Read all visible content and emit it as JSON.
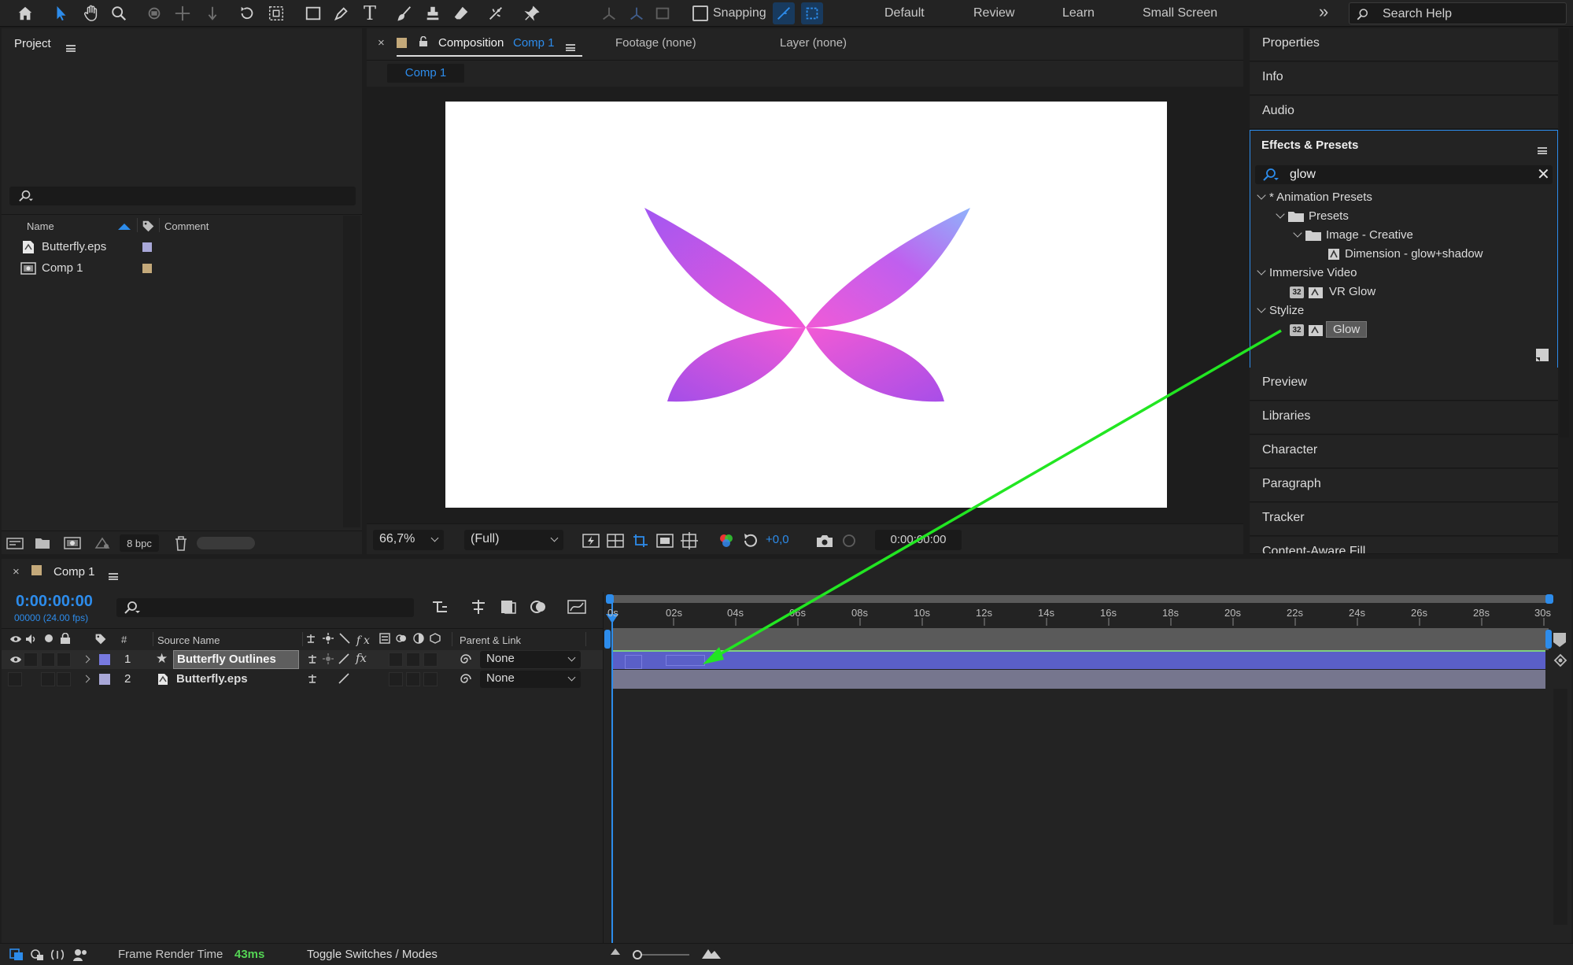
{
  "toolbar": {
    "tools": [
      "home-icon",
      "selection-arrow-icon",
      "hand-icon",
      "zoom-icon",
      "rotate-camera-icon",
      "pan-camera-icon",
      "dolly-camera-icon",
      "rotation-icon",
      "pan-behind-icon",
      "rectangle-icon",
      "pen-icon",
      "type-icon",
      "brush-icon",
      "clone-stamp-icon",
      "eraser-icon",
      "roto-brush-icon",
      "puppet-pin-icon"
    ],
    "snapping_label": "Snapping",
    "workspaces": [
      "Default",
      "Review",
      "Learn",
      "Small Screen"
    ],
    "more": "»",
    "search_placeholder": "Search Help"
  },
  "project": {
    "title": "Project",
    "col_name": "Name",
    "col_comment": "Comment",
    "items": [
      {
        "name": "Butterfly.eps",
        "color": "#a9a8d8",
        "icon": "eps-file-icon"
      },
      {
        "name": "Comp 1",
        "color": "#c4a97a",
        "icon": "composition-icon"
      }
    ],
    "bpc": "8 bpc"
  },
  "composition": {
    "tab_prefix": "Composition",
    "tab_comp": "Comp 1",
    "footage_tab": "Footage (none)",
    "layer_tab": "Layer (none)",
    "subtab": "Comp 1",
    "zoom": "66,7%",
    "resolution": "(Full)",
    "exposure": "+0,0",
    "timecode": "0:00:00:00"
  },
  "right_panels": {
    "top": [
      "Properties",
      "Info",
      "Audio"
    ],
    "effects_title": "Effects & Presets",
    "search_value": "glow",
    "tree": [
      {
        "label": "* Animation Presets"
      },
      {
        "label": "Presets"
      },
      {
        "label": "Image - Creative"
      },
      {
        "label": "Dimension - glow+shadow"
      },
      {
        "label": "Immersive Video"
      },
      {
        "label": "VR Glow"
      },
      {
        "label": "Stylize"
      },
      {
        "label": "Glow"
      }
    ],
    "bottom": [
      "Preview",
      "Libraries",
      "Character",
      "Paragraph",
      "Tracker",
      "Content-Aware Fill"
    ]
  },
  "timeline": {
    "tab": "Comp 1",
    "timecode": "0:00:00:00",
    "frames": "00000 (24.00 fps)",
    "col_num": "#",
    "col_source": "Source Name",
    "col_parent": "Parent & Link",
    "ticks": [
      "0s",
      "02s",
      "04s",
      "06s",
      "08s",
      "10s",
      "12s",
      "14s",
      "16s",
      "18s",
      "20s",
      "22s",
      "24s",
      "26s",
      "28s",
      "30s"
    ],
    "layers": [
      {
        "num": "1",
        "name": "Butterfly Outlines",
        "color": "#7779e0",
        "parent": "None",
        "icon": "star-shape-layer-icon"
      },
      {
        "num": "2",
        "name": "Butterfly.eps",
        "color": "#a9a8d8",
        "parent": "None",
        "icon": "eps-file-icon"
      }
    ],
    "frame_render_label": "Frame Render Time",
    "frame_render_value": "43ms",
    "toggle_label": "Toggle Switches / Modes"
  },
  "colors": {
    "accent_blue": "#2d8ceb",
    "drag_arrow": "#22e622",
    "layer1_bar": "#5a5fc8",
    "layer2_bar": "#76768e"
  }
}
